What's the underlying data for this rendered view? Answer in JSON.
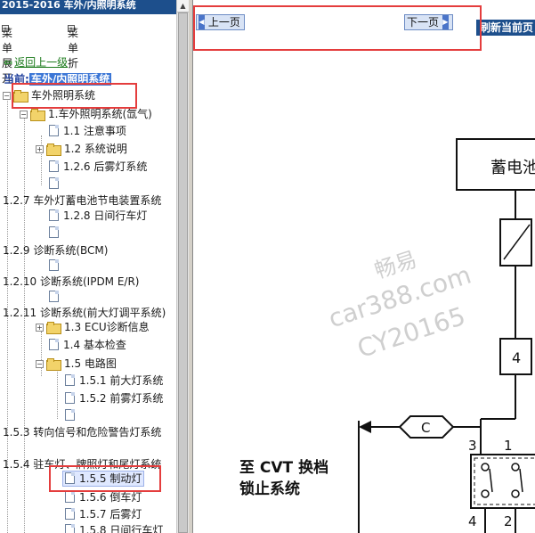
{
  "left": {
    "top_title": "2015-2016 车外/内照明系统",
    "menu": {
      "expand": "菜单展开",
      "collapse": "菜单折叠"
    },
    "back": "返回上一级",
    "current": {
      "label": "当前:",
      "value": "车外/内照明系统"
    },
    "tree": [
      {
        "text": "车外照明系统"
      },
      {
        "text": "1.车外照明系统(氙气)"
      },
      {
        "text": "1.1 注意事项"
      },
      {
        "text": "1.2 系统说明"
      },
      {
        "text": "1.2.6 后雾灯系统"
      },
      {
        "text": ""
      },
      {
        "text": "1.2.7 车外灯蓄电池节电装置系统"
      },
      {
        "text": "1.2.8 日间行车灯"
      },
      {
        "text": ""
      },
      {
        "text": "1.2.9 诊断系统(BCM)"
      },
      {
        "text": ""
      },
      {
        "text": "1.2.10 诊断系统(IPDM E/R)"
      },
      {
        "text": ""
      },
      {
        "text": "1.2.11 诊断系统(前大灯调平系统)"
      },
      {
        "text": "1.3 ECU诊断信息"
      },
      {
        "text": "1.4 基本检查"
      },
      {
        "text": "1.5 电路图"
      },
      {
        "text": "1.5.1 前大灯系统"
      },
      {
        "text": "1.5.2 前雾灯系统"
      },
      {
        "text": ""
      },
      {
        "text": "1.5.3 转向信号和危险警告灯系统"
      },
      {
        "text": "1.5.4 驻车灯、牌照灯和尾灯系统"
      },
      {
        "text": "1.5.5 制动灯"
      },
      {
        "text": "1.5.6 倒车灯"
      },
      {
        "text": "1.5.7 后雾灯"
      },
      {
        "text": "1.5.8 日间行车灯"
      }
    ]
  },
  "right": {
    "prev_label": "上一页",
    "next_label": "下一页",
    "refresh_label": "刷新当前页",
    "diagram": {
      "battery_label": "蓄电池",
      "fuse_label": "4",
      "connector_c": "C",
      "pin_3": "3",
      "pin_1": "1",
      "pin_4": "4",
      "pin_2": "2",
      "cvt_line1": "至 CVT 换档",
      "cvt_line2": "锁止系统",
      "watermark": [
        "畅易",
        "car388.com",
        "CY20165"
      ]
    }
  },
  "colors": {
    "title_bar": "#1d4f8c",
    "highlight_box": "#e43d3d",
    "current_bg": "#3b76d6",
    "back_link": "#1b7a1b"
  }
}
